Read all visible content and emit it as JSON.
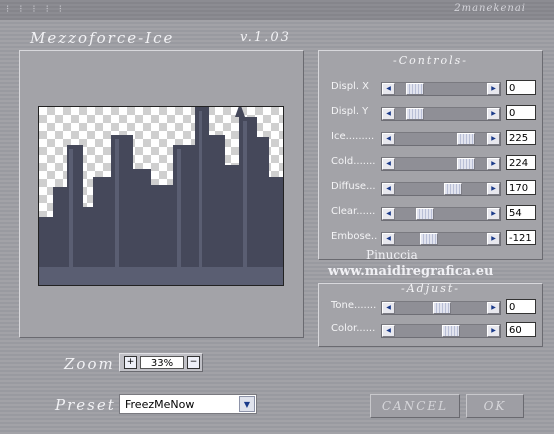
{
  "titlebar": {
    "dots": "⁝ ⁝ ⁝ ⁝ ⁝",
    "author": "2manekenai"
  },
  "header": {
    "title": "Mezzoforce-Ice",
    "version": "v.1.03"
  },
  "controls": {
    "heading": "-Controls-",
    "rows": [
      {
        "label": "Displ. X",
        "value": "0",
        "position": 0.15
      },
      {
        "label": "Displ. Y",
        "value": "0",
        "position": 0.15
      },
      {
        "label": "Ice.........",
        "value": "225",
        "position": 0.82
      },
      {
        "label": "Cold.......",
        "value": "224",
        "position": 0.82
      },
      {
        "label": "Diffuse...",
        "value": "170",
        "position": 0.65
      },
      {
        "label": "Clear......",
        "value": "54",
        "position": 0.28
      },
      {
        "label": "Embose..",
        "value": "-121",
        "position": 0.33
      }
    ]
  },
  "adjust": {
    "heading": "-Adjust-",
    "rows": [
      {
        "label": "Tone.......",
        "value": "0",
        "position": 0.5
      },
      {
        "label": "Color......",
        "value": "60",
        "position": 0.62
      }
    ]
  },
  "watermark": {
    "line1": "Pinuccia",
    "line2": "www.maidiregrafica.eu"
  },
  "zoom": {
    "label": "Zoom",
    "value": "33%",
    "plus": "+",
    "minus": "−"
  },
  "preset": {
    "label": "Preset",
    "value": "FreezMeNow"
  },
  "buttons": {
    "cancel": "CANCEL",
    "ok": "OK"
  },
  "colors": {
    "city": "#45485a",
    "city_light": "#5a5e72",
    "accent": "#b9bfd6"
  }
}
